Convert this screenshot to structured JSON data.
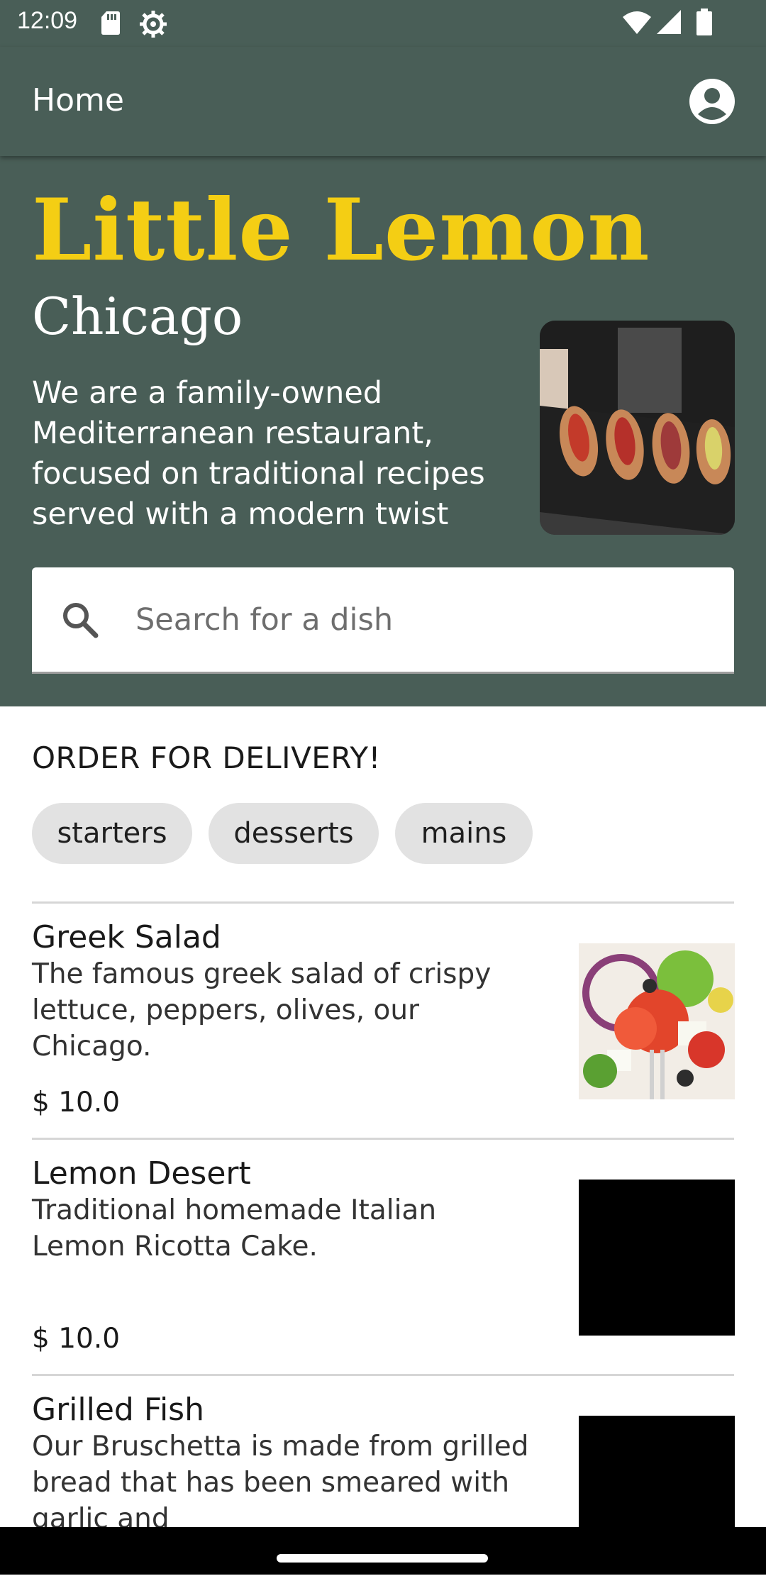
{
  "status_bar": {
    "time": "12:09",
    "icons": [
      "sd-card-icon",
      "gear-icon",
      "wifi-icon",
      "signal-icon",
      "battery-icon"
    ]
  },
  "app_bar": {
    "title": "Home",
    "profile_icon": "account-circle-icon"
  },
  "hero": {
    "title": "Little Lemon",
    "city": "Chicago",
    "description": "We are a family-owned Mediterranean restaurant, focused on traditional recipes served with a modern twist",
    "image": "bruschetta-platter-photo"
  },
  "search": {
    "placeholder": "Search for a dish",
    "value": "",
    "icon": "search-icon"
  },
  "delivery": {
    "heading": "ORDER FOR DELIVERY!",
    "categories": [
      "starters",
      "desserts",
      "mains"
    ]
  },
  "menu_items": [
    {
      "name": "Greek Salad",
      "description": "The famous greek salad of crispy lettuce, peppers, olives, our Chicago.",
      "price": "$ 10.0",
      "image": "greek-salad-photo"
    },
    {
      "name": "Lemon Desert",
      "description": "Traditional homemade Italian Lemon Ricotta Cake.",
      "price": "$ 10.0",
      "image": "blank-image"
    },
    {
      "name": "Grilled Fish",
      "description": "Our Bruschetta is made from grilled bread that has been smeared with garlic and",
      "price": "",
      "image": "blank-image"
    }
  ],
  "colors": {
    "primary_green": "#495e57",
    "accent_yellow": "#f4ce14",
    "chip_background": "#e2e2e2"
  }
}
